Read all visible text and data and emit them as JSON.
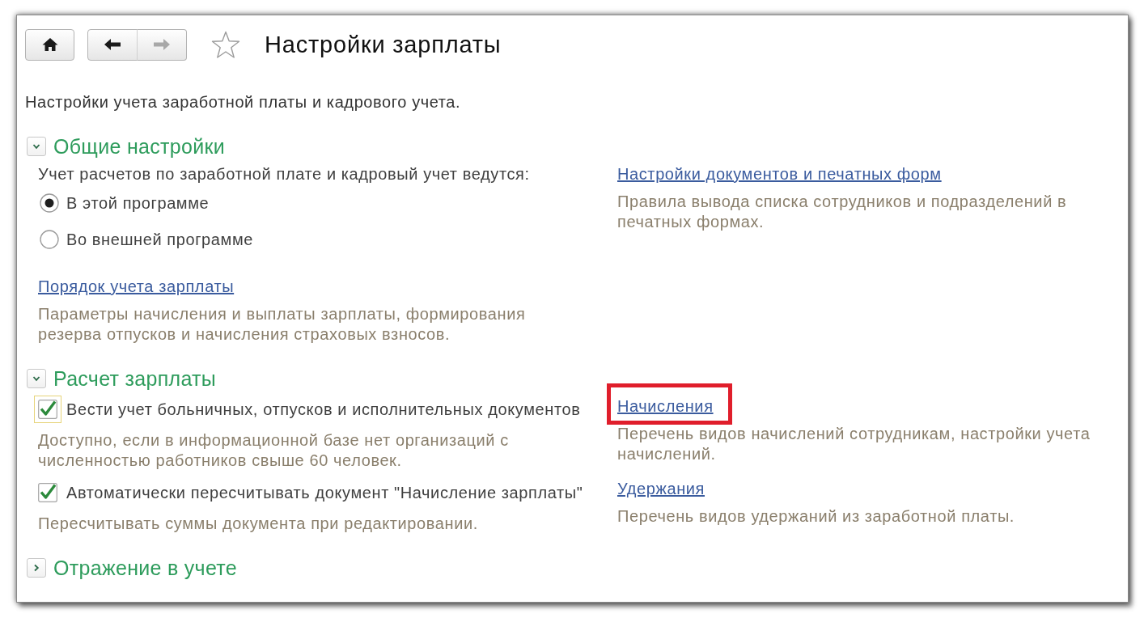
{
  "toolbar": {
    "home": {
      "disabled": false
    },
    "history": [
      {
        "kind": "back",
        "disabled": false
      },
      {
        "kind": "forward",
        "disabled": true
      }
    ],
    "favorite": false,
    "title": "Настройки зарплаты"
  },
  "description": "Настройки учета заработной платы и кадрового учета.",
  "sections": [
    {
      "title": "Общие настройки",
      "expanded": true,
      "left": [
        {
          "kind": "label",
          "text": "Учет расчетов по заработной плате и кадровый учет ведутся:"
        },
        {
          "kind": "radio",
          "text": "В этой программе",
          "selected": true
        },
        {
          "kind": "radio",
          "text": "Во внешней программе",
          "selected": false
        },
        {
          "kind": "link",
          "text": "Порядок учета зарплаты",
          "highlighted": false
        },
        {
          "kind": "hint",
          "text": "Параметры начисления и выплаты зарплаты, формирования резерва отпусков и начисления страховых взносов."
        }
      ],
      "right": [
        {
          "kind": "link",
          "text": "Настройки документов и печатных форм",
          "highlighted": false
        },
        {
          "kind": "hint",
          "text": "Правила вывода списка сотрудников и подразделений в печатных формах."
        }
      ]
    },
    {
      "title": "Расчет зарплаты",
      "expanded": true,
      "left": [
        {
          "kind": "checkbox",
          "text": "Вести учет больничных, отпусков и исполнительных документов",
          "checked": true,
          "focused": true
        },
        {
          "kind": "hint",
          "text": "Доступно, если в информационной базе нет организаций с численностью работников свыше 60 человек."
        },
        {
          "kind": "checkbox",
          "text": "Автоматически пересчитывать документ \"Начисление зарплаты\"",
          "checked": true,
          "focused": false
        },
        {
          "kind": "hint",
          "text": "Пересчитывать суммы документа при редактировании."
        }
      ],
      "right": [
        {
          "kind": "link",
          "text": "Начисления",
          "highlighted": true
        },
        {
          "kind": "hint",
          "text": "Перечень видов начислений сотрудникам, настройки учета начислений."
        },
        {
          "kind": "link",
          "text": "Удержания",
          "highlighted": false
        },
        {
          "kind": "hint",
          "text": "Перечень видов удержаний из заработной платы."
        }
      ]
    },
    {
      "title": "Отражение в учете",
      "expanded": false
    }
  ]
}
